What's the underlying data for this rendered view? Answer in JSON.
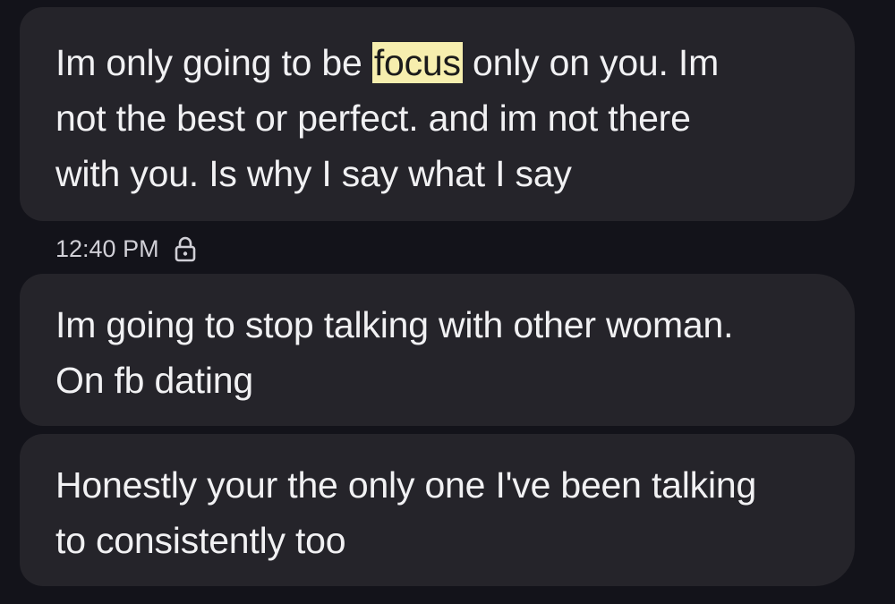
{
  "messages": [
    {
      "lines": [
        {
          "before": "Im only going to be ",
          "highlight": "focus",
          "after": " only on you. Im"
        },
        {
          "text": "not the best or perfect. and im not there"
        },
        {
          "text": "with you. Is why I say what I say"
        }
      ]
    },
    {
      "timestamp": "12:40 PM",
      "status_icon": "lock-icon",
      "lines": [
        {
          "text": "Im going to stop talking with other woman."
        },
        {
          "text": "On fb dating"
        }
      ]
    },
    {
      "lines": [
        {
          "text": "Honestly your the only one I've been talking"
        },
        {
          "text": "to consistently too"
        }
      ]
    }
  ],
  "colors": {
    "background": "#13131a",
    "bubble": "#25242a",
    "text": "#f1f1f3",
    "meta_text": "#d0cfd6",
    "search_highlight": "#f6eeae"
  }
}
